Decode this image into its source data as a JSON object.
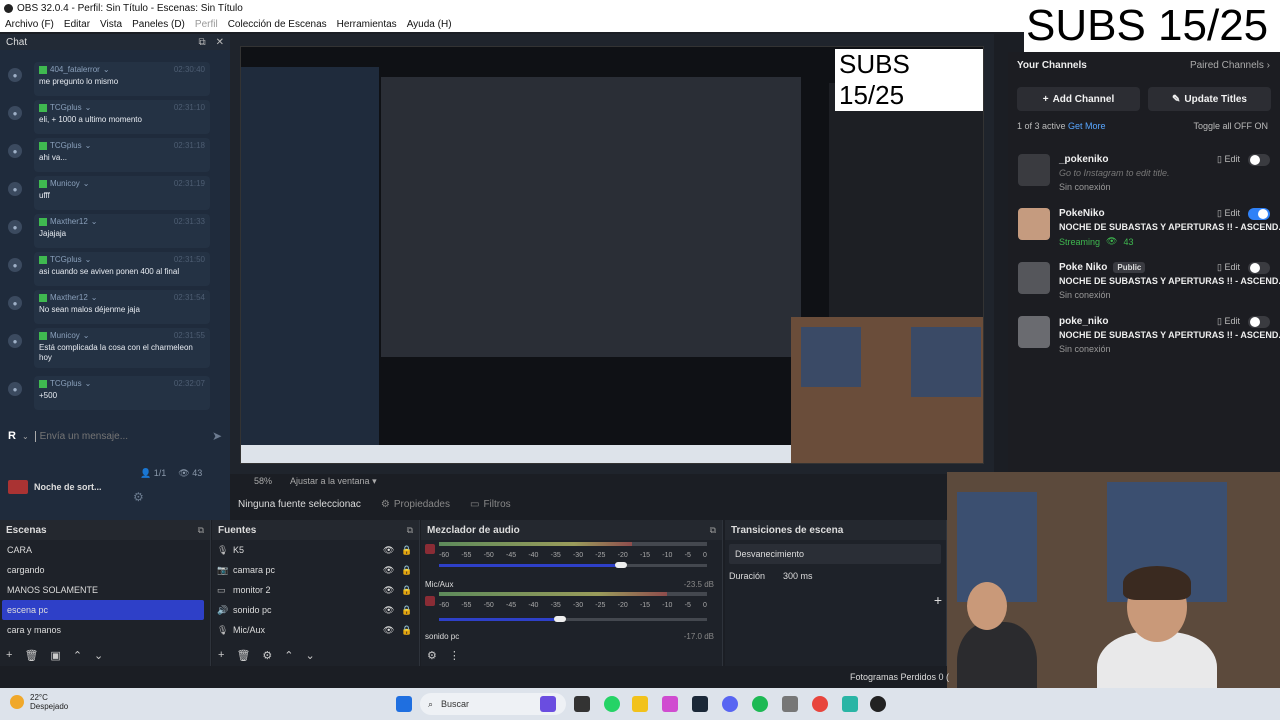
{
  "window": {
    "title": "OBS 32.0.4 - Perfil: Sin Título - Escenas: Sin Título"
  },
  "menu": [
    "Archivo (F)",
    "Editar",
    "Vista",
    "Paneles (D)",
    "Perfil",
    "Colección de Escenas",
    "Herramientas",
    "Ayuda (H)"
  ],
  "chat": {
    "title": "Chat",
    "messages": [
      {
        "user": "404_fatalerror",
        "time": "02:30:40",
        "text": "me pregunto lo mismo"
      },
      {
        "user": "TCGplus",
        "time": "02:31:10",
        "text": "eli, + 1000 a ultimo momento"
      },
      {
        "user": "TCGplus",
        "time": "02:31:18",
        "text": "ahi va..."
      },
      {
        "user": "Municoy",
        "time": "02:31:19",
        "text": "ufff"
      },
      {
        "user": "Maxther12",
        "time": "02:31:33",
        "text": "Jajajaja"
      },
      {
        "user": "TCGplus",
        "time": "02:31:50",
        "text": "asi cuando se aviven ponen 400 al final"
      },
      {
        "user": "Maxther12",
        "time": "02:31:54",
        "text": "No sean malos déjenme jaja"
      },
      {
        "user": "Municoy",
        "time": "02:31:55",
        "text": "Está complicada la cosa con el charmeleon hoy"
      },
      {
        "user": "TCGplus",
        "time": "02:32:07",
        "text": "+500"
      }
    ],
    "input_placeholder": "Envía un mensaje...",
    "avatar_letter": "R",
    "viewers_ratio": "1/1",
    "viewers": "43",
    "stream_name": "Noche de sort..."
  },
  "subs": "SUBS 15/25",
  "channels": {
    "title": "Your Channels",
    "paired": "Paired Channels",
    "add": "Add Channel",
    "update": "Update Titles",
    "active": "1 of 3 active",
    "get_more": "Get More",
    "toggle_all": "Toggle all OFF",
    "toggle_on": "ON",
    "edit": "Edit",
    "items": [
      {
        "name": "_pokeniko",
        "public": "",
        "title": "Go to Instagram to edit title.",
        "status": "Sin conexión",
        "viewers": "",
        "on": false
      },
      {
        "name": "PokeNiko",
        "public": "",
        "title": "NOCHE DE SUBASTAS Y APERTURAS !! - ASCEND...",
        "status": "Streaming",
        "viewers": "43",
        "on": true
      },
      {
        "name": "Poke Niko",
        "public": "Public",
        "title": "NOCHE DE SUBASTAS Y APERTURAS !! - ASCEND...",
        "status": "Sin conexión",
        "viewers": "",
        "on": false
      },
      {
        "name": "poke_niko",
        "public": "",
        "title": "NOCHE DE SUBASTAS Y APERTURAS !! - ASCEND...",
        "status": "Sin conexión",
        "viewers": "",
        "on": false
      }
    ]
  },
  "preview_toolbar": {
    "zoom": "58%",
    "fit": "Ajustar a la ventana"
  },
  "source_bar": {
    "none": "Ninguna fuente seleccionac",
    "props": "Propiedades",
    "filters": "Filtros"
  },
  "scenes": {
    "title": "Escenas",
    "items": [
      "CARA",
      "cargando",
      "MANOS SOLAMENTE",
      "escena pc",
      "cara y manos"
    ],
    "selected": 3
  },
  "sources": {
    "title": "Fuentes",
    "items": [
      {
        "icon": "mic-icon",
        "name": "K5"
      },
      {
        "icon": "camera-icon",
        "name": "camara pc"
      },
      {
        "icon": "monitor-icon",
        "name": "monitor 2"
      },
      {
        "icon": "speaker-icon",
        "name": "sonido pc"
      },
      {
        "icon": "mic-icon",
        "name": "Mic/Aux"
      }
    ]
  },
  "mixer": {
    "title": "Mezclador de audio",
    "scale": [
      "-60",
      "-55",
      "-50",
      "-45",
      "-40",
      "-35",
      "-30",
      "-25",
      "-20",
      "-15",
      "-10",
      "-5",
      "0"
    ],
    "channels": [
      {
        "name": "",
        "db": "",
        "level": 0.72,
        "fader": 0.68
      },
      {
        "name": "Mic/Aux",
        "db": "-23.5 dB",
        "level": 0.85,
        "fader": 0.45
      },
      {
        "name": "sonido pc",
        "db": "-17.0 dB",
        "level": 0.0,
        "fader": 0.0
      }
    ]
  },
  "transitions": {
    "title": "Transiciones de escena",
    "type": "Desvanecimiento",
    "duration_label": "Duración",
    "duration": "300 ms"
  },
  "status": {
    "frames": "Fotogramas Perdidos 0 ("
  },
  "taskbar": {
    "temp": "22°C",
    "weather": "Despejado",
    "search": "Buscar"
  }
}
